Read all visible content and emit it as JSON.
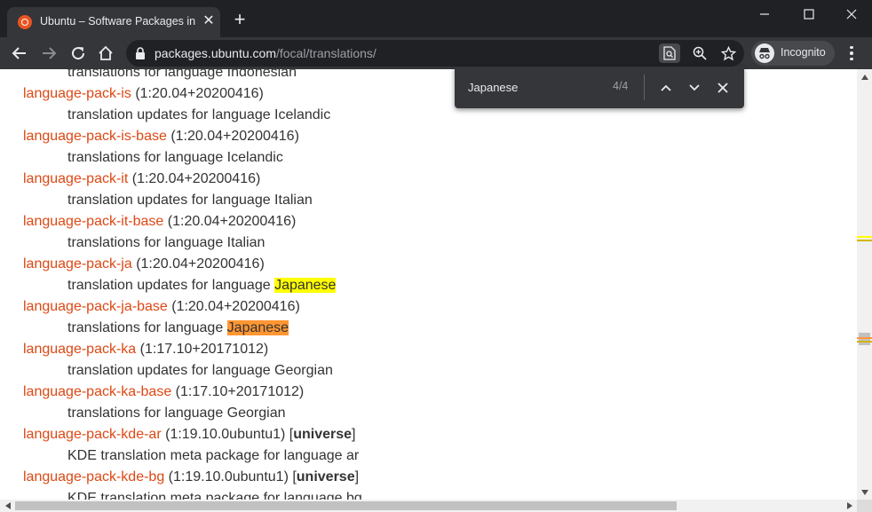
{
  "browser": {
    "tab_title": "Ubuntu – Software Packages in \"focal\", Translations",
    "url_host": "packages.ubuntu.com",
    "url_path": "/focal/translations/",
    "profile_label": "Incognito"
  },
  "find": {
    "query": "Japanese",
    "count": "4/4"
  },
  "page": {
    "top_partial": "translations for language Indonesian",
    "bottom_partial": "KDE translation meta package for language bg",
    "packages": [
      {
        "name": "language-pack-is",
        "version": "(1:20.04+20200416)",
        "desc": "translation updates for language Icelandic"
      },
      {
        "name": "language-pack-is-base",
        "version": "(1:20.04+20200416)",
        "desc": "translations for language Icelandic"
      },
      {
        "name": "language-pack-it",
        "version": "(1:20.04+20200416)",
        "desc": "translation updates for language Italian"
      },
      {
        "name": "language-pack-it-base",
        "version": "(1:20.04+20200416)",
        "desc": "translations for language Italian"
      },
      {
        "name": "language-pack-ja",
        "version": "(1:20.04+20200416)",
        "desc_prefix": "translation updates for language ",
        "desc_match": "Japanese"
      },
      {
        "name": "language-pack-ja-base",
        "version": "(1:20.04+20200416)",
        "desc_prefix": "translations for language ",
        "desc_match": "Japanese"
      },
      {
        "name": "language-pack-ka",
        "version": "(1:17.10+20171012)",
        "desc": "translation updates for language Georgian"
      },
      {
        "name": "language-pack-ka-base",
        "version": "(1:17.10+20171012)",
        "desc": "translations for language Georgian"
      },
      {
        "name": "language-pack-kde-ar",
        "version": "(1:19.10.0ubuntu1)",
        "section": "universe",
        "desc": "KDE translation meta package for language ar"
      },
      {
        "name": "language-pack-kde-bg",
        "version": "(1:19.10.0ubuntu1)",
        "section": "universe"
      }
    ]
  },
  "colors": {
    "link": "#dd4814",
    "highlight": "#ffff00",
    "highlight_active": "#ff9632"
  }
}
